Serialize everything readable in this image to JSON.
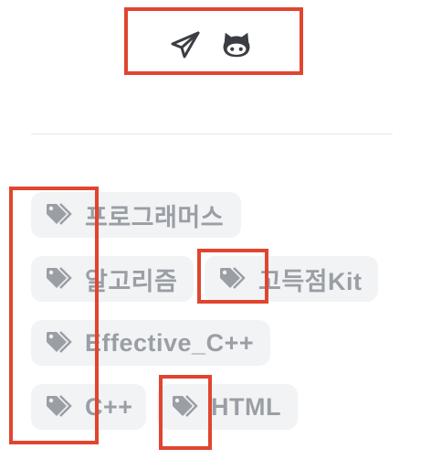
{
  "social": {
    "links": [
      {
        "name": "telegram",
        "icon": "paper-plane-icon"
      },
      {
        "name": "github",
        "icon": "github-icon"
      }
    ]
  },
  "tags": [
    {
      "label": "프로그래머스",
      "icon": "tag-icon"
    },
    {
      "label": "알고리즘",
      "icon": "tag-icon"
    },
    {
      "label": "고득점Kit",
      "icon": "tag-icon"
    },
    {
      "label": "Effective_C++",
      "icon": "tag-icon"
    },
    {
      "label": "C++",
      "icon": "tag-icon"
    },
    {
      "label": "HTML",
      "icon": "tag-icon"
    }
  ],
  "colors": {
    "highlight": "#e0452f",
    "tag_bg": "#f2f3f5",
    "tag_text": "#9a9ea5",
    "icon": "#3a3d42"
  }
}
